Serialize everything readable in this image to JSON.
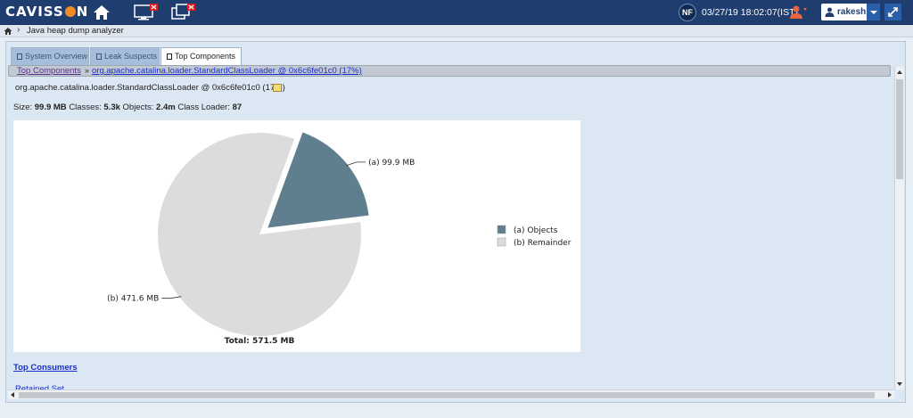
{
  "app": {
    "logo_text_left": "CAVISS",
    "logo_text_right": "N",
    "user_initials": "NF",
    "datetime": "03/27/19 18:02:07(IST)",
    "username": "rakesh"
  },
  "breadcrumb": {
    "label": "Java heap dump analyzer"
  },
  "tabs": [
    {
      "label": "System Overview",
      "active": false
    },
    {
      "label": "Leak Suspects",
      "active": false
    },
    {
      "label": "Top Components",
      "active": true
    }
  ],
  "content": {
    "crumb_first": "Top Components",
    "crumb_sep": "»",
    "crumb_second": "org.apache.catalina.loader.StandardClassLoader @ 0x6c6fe01c0 (17%)",
    "object_title": "org.apache.catalina.loader.StandardClassLoader @ 0x6c6fe01c0 (17%)",
    "summary": {
      "size_label": "Size:",
      "size_value": "99.9 MB",
      "classes_label": "Classes:",
      "classes_value": "5.3k",
      "objects_label": "Objects:",
      "objects_value": "2.4m",
      "loader_label": "Class Loader:",
      "loader_value": "87"
    },
    "top_consumers": "Top Consumers",
    "retained_set": "Retained Set"
  },
  "colors": {
    "objects": "#5f7f8f",
    "remainder": "#dcdcdc",
    "topbar": "#1f3d6e"
  },
  "chart_data": {
    "type": "pie",
    "slices": [
      {
        "key": "(a)",
        "name": "Objects",
        "value": 99.9,
        "label": "(a)  99.9 MB",
        "color": "#5f7f8f",
        "exploded": true
      },
      {
        "key": "(b)",
        "name": "Remainder",
        "value": 471.6,
        "label": "(b)  471.6 MB",
        "color": "#dcdcdc",
        "exploded": false
      }
    ],
    "legend": [
      {
        "key": "(a)",
        "name": "Objects",
        "text": "(a)  Objects"
      },
      {
        "key": "(b)",
        "name": "Remainder",
        "text": "(b)  Remainder"
      }
    ],
    "total_label": "Total: 571.5 MB",
    "legend_position": "right"
  }
}
